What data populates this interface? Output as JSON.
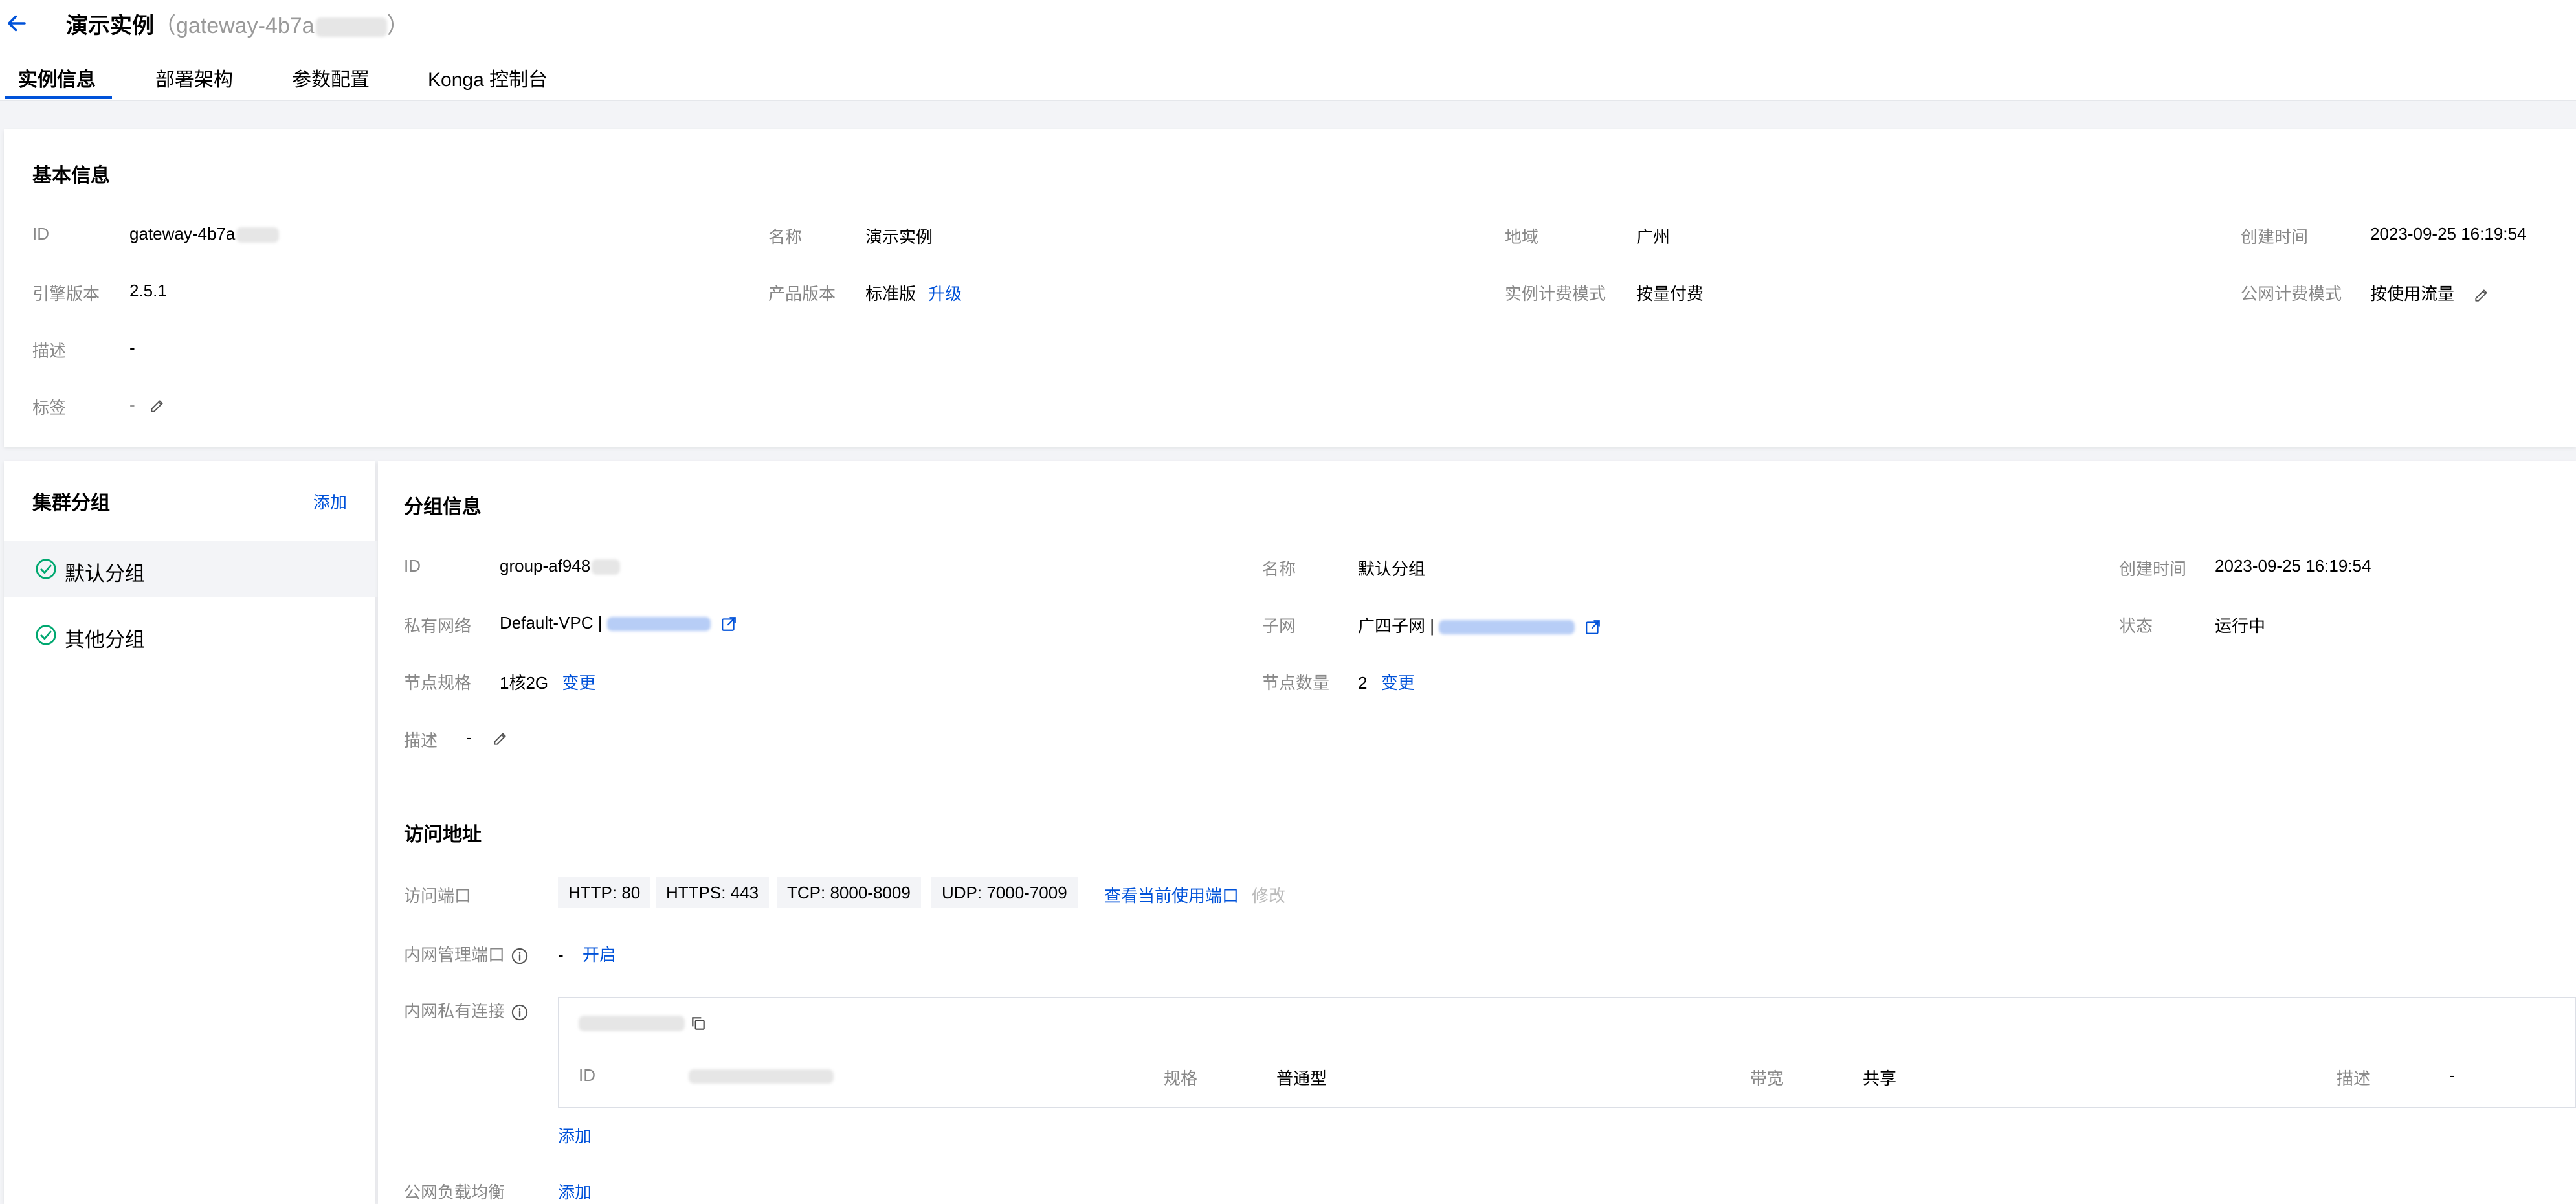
{
  "header": {
    "title": "演示实例",
    "title_id_prefix": "（gateway-4b7a",
    "tabs": [
      {
        "label": "实例信息",
        "active": true
      },
      {
        "label": "部署架构",
        "active": false
      },
      {
        "label": "参数配置",
        "active": false
      },
      {
        "label": "Konga 控制台",
        "active": false
      }
    ]
  },
  "basic_info": {
    "title": "基本信息",
    "id_label": "ID",
    "id_value": "gateway-4b7a",
    "name_label": "名称",
    "name_value": "演示实例",
    "region_label": "地域",
    "region_value": "广州",
    "created_label": "创建时间",
    "created_value": "2023-09-25 16:19:54",
    "engine_label": "引擎版本",
    "engine_value": "2.5.1",
    "edition_label": "产品版本",
    "edition_value": "标准版",
    "upgrade_link": "升级",
    "billing_label": "实例计费模式",
    "billing_value": "按量付费",
    "net_billing_label": "公网计费模式",
    "net_billing_value": "按使用流量",
    "desc_label": "描述",
    "desc_value": "-",
    "tag_label": "标签",
    "tag_value": "-"
  },
  "sidebar": {
    "title": "集群分组",
    "add_link": "添加",
    "groups": [
      {
        "name": "默认分组",
        "selected": true
      },
      {
        "name": "其他分组",
        "selected": false
      }
    ]
  },
  "group_info": {
    "title": "分组信息",
    "id_label": "ID",
    "id_value": "group-af948",
    "name_label": "名称",
    "name_value": "默认分组",
    "created_label": "创建时间",
    "created_value": "2023-09-25 16:19:54",
    "vpc_label": "私有网络",
    "vpc_value": "Default-VPC |",
    "subnet_label": "子网",
    "subnet_value": "广四子网 |",
    "status_label": "状态",
    "status_value": "运行中",
    "spec_label": "节点规格",
    "spec_value": "1核2G",
    "spec_change": "变更",
    "count_label": "节点数量",
    "count_value": "2",
    "count_change": "变更",
    "desc_label": "描述",
    "desc_value": "-"
  },
  "access": {
    "title": "访问地址",
    "ports_label": "访问端口",
    "ports": [
      "HTTP: 80",
      "HTTPS: 443",
      "TCP: 8000-8009",
      "UDP: 7000-7009"
    ],
    "view_ports_link": "查看当前使用端口",
    "modify_link": "修改",
    "admin_port_label": "内网管理端口",
    "admin_port_value": "-",
    "admin_port_enable": "开启",
    "private_link_label": "内网私有连接",
    "private_link": {
      "id_label": "ID",
      "spec_label": "规格",
      "spec_value": "普通型",
      "bandwidth_label": "带宽",
      "bandwidth_value": "共享",
      "desc_label": "描述",
      "desc_value": "-"
    },
    "private_add_link": "添加",
    "public_lb_label": "公网负载均衡",
    "public_add_link": "添加"
  },
  "colors": {
    "brand_blue": "#0052d9",
    "success_green": "#00a870",
    "label_gray": "#888888",
    "page_bg": "#f3f4f7"
  },
  "icons": [
    "arrow-left-icon",
    "edit-icon",
    "external-link-icon",
    "check-circle-icon",
    "info-circle-icon",
    "copy-icon"
  ]
}
